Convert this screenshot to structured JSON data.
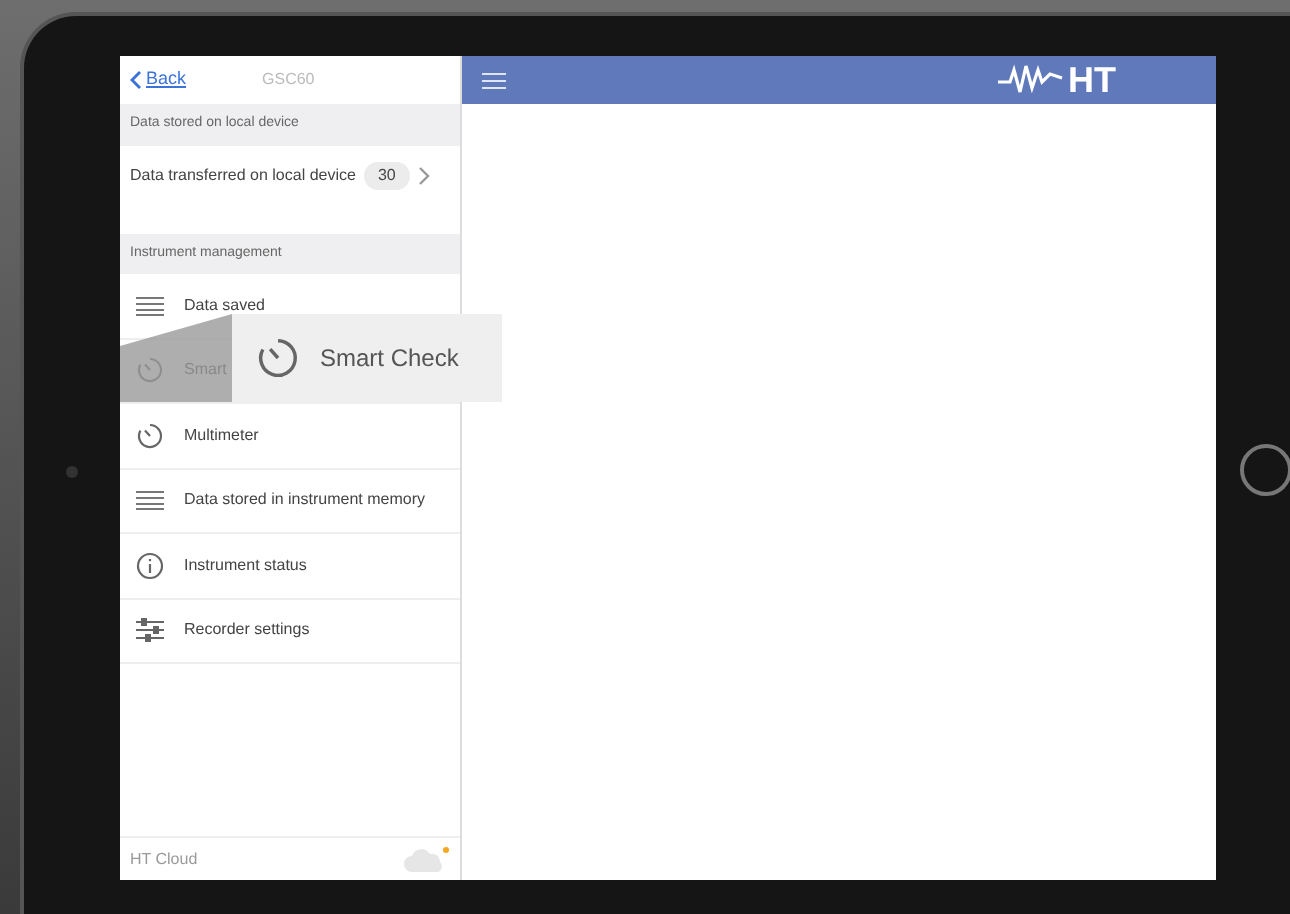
{
  "nav": {
    "back": "Back",
    "title": "GSC60"
  },
  "local_section": {
    "header": "Data stored on local device",
    "row": {
      "label": "Data transferred on local device",
      "count": "30"
    }
  },
  "instrument_section": {
    "header": "Instrument management",
    "items": [
      {
        "kind": "list",
        "label": "Data saved"
      },
      {
        "kind": "timer",
        "label": "Smart"
      },
      {
        "kind": "timer",
        "label": "Multimeter"
      },
      {
        "kind": "list",
        "label": "Data stored in instrument memory"
      },
      {
        "kind": "info",
        "label": "Instrument status"
      },
      {
        "kind": "settings",
        "label": "Recorder settings"
      }
    ]
  },
  "footer": {
    "label": "HT Cloud"
  },
  "callout": {
    "label": "Smart Check"
  },
  "header_bar": {
    "logo": "HT"
  }
}
